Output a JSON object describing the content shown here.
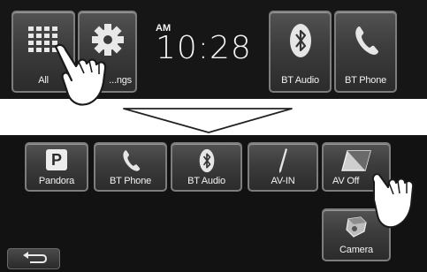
{
  "top_screen": {
    "tiles": [
      {
        "label": "All",
        "icon": "grid-icon"
      },
      {
        "label": "...ngs",
        "icon": "gear-icon"
      },
      {
        "label": "BT Audio",
        "icon": "bluetooth-icon"
      },
      {
        "label": "BT Phone",
        "icon": "phone-icon"
      }
    ],
    "clock": {
      "ampm": "AM",
      "time": "10:28"
    }
  },
  "bottom_screen": {
    "tiles": [
      {
        "label": "Pandora",
        "icon": "pandora-icon",
        "glyph": "P"
      },
      {
        "label": "BT Phone",
        "icon": "phone-icon"
      },
      {
        "label": "BT Audio",
        "icon": "bluetooth-icon"
      },
      {
        "label": "AV-IN",
        "icon": "av-in-icon"
      },
      {
        "label": "AV Off",
        "icon": "av-off-icon"
      },
      {
        "label": "Camera",
        "icon": "camera-icon"
      }
    ],
    "back_button": {
      "icon": "back-arrow-icon"
    }
  }
}
